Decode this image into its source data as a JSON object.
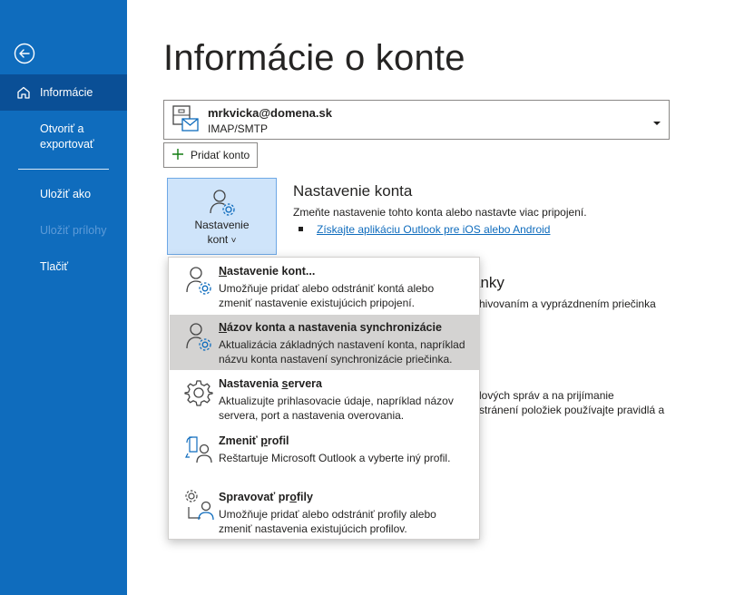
{
  "sidebar": {
    "items": [
      {
        "label": "Informácie",
        "active": true
      },
      {
        "label_line1": "Otvoriť a",
        "label_line2": "exportovať"
      },
      {
        "label": "Uložiť ako"
      },
      {
        "label": "Uložiť prílohy",
        "disabled": true
      },
      {
        "label": "Tlačiť"
      }
    ]
  },
  "page": {
    "title": "Informácie o konte"
  },
  "account": {
    "email": "mrkvicka@domena.sk",
    "type": "IMAP/SMTP"
  },
  "add_account": {
    "label": "Pridať konto"
  },
  "settings_tile": {
    "line1": "Nastavenie",
    "line2": "kont",
    "caret": "˅"
  },
  "section": {
    "title": "Nastavenie konta",
    "description": "Zmeňte nastavenie tohto konta alebo nastavte viac pripojení.",
    "link": "Získajte aplikáciu Outlook pre iOS alebo Android"
  },
  "background_text": {
    "t1": "ánky",
    "t2": "hivovaním a vyprázdnením priečinka",
    "t3": "lových správ a na prijímanie",
    "t4": "stránení položiek používajte pravidlá a"
  },
  "menu": {
    "items": [
      {
        "title_pre": "",
        "title_u": "N",
        "title_post": "astavenie kont...",
        "desc_line1": "Umožňuje pridať alebo odstrániť kontá alebo",
        "desc_line2": "zmeniť nastavenie existujúcich pripojení.",
        "icon": "user-gear-icon"
      },
      {
        "title_pre": "",
        "title_u": "N",
        "title_post": "ázov konta a nastavenia synchronizácie",
        "desc_line1": "Aktualizácia základných nastavení konta, napríklad",
        "desc_line2": "názvu konta nastavení synchronizácie priečinka.",
        "icon": "user-gear-icon",
        "hovered": true
      },
      {
        "title_pre": "Nastavenia ",
        "title_u": "s",
        "title_post": "ervera",
        "desc_line1": "Aktualizujte prihlasovacie údaje, napríklad názov",
        "desc_line2": "servera, port a nastavenia overovania.",
        "icon": "gear-icon"
      },
      {
        "title_pre": "Zmeniť ",
        "title_u": "p",
        "title_post": "rofil",
        "desc_line1": "Reštartuje Microsoft Outlook a vyberte iný profil.",
        "icon": "switch-profile-icon"
      },
      {
        "title_pre": "Spravovať pr",
        "title_u": "o",
        "title_post": "fily",
        "desc_line1": "Umožňuje pridať alebo odstrániť profily alebo",
        "desc_line2": "zmeniť nastavenia existujúcich profilov.",
        "icon": "manage-profiles-icon"
      }
    ]
  },
  "colors": {
    "sidebar": "#0f6cbd",
    "sidebar_active": "#0a4f96",
    "tile_bg": "#cfe4fa",
    "menu_hover": "#d4d3d2",
    "link": "#0f6cbd"
  }
}
